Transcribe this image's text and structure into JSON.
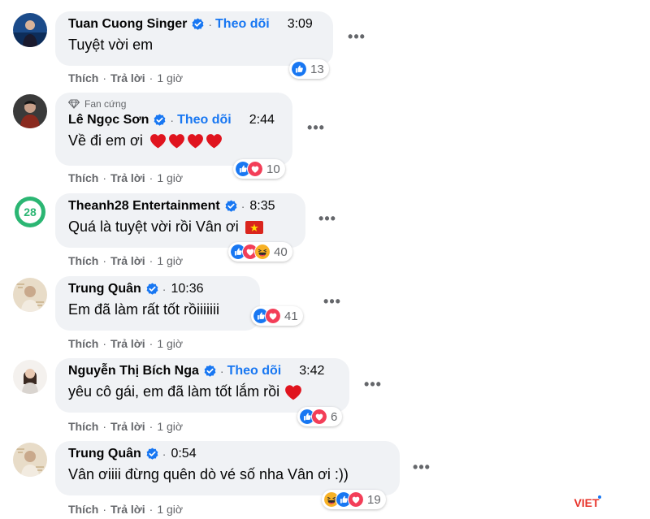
{
  "comments": [
    {
      "author": "Tuan Cuong Singer",
      "follow": "Theo dõi",
      "time": "3:09",
      "text": "Tuyệt vời em",
      "reaction_count": "13",
      "actions": {
        "like": "Thích",
        "reply": "Trả lời",
        "ago": "1 giờ"
      }
    },
    {
      "badge": "Fan cứng",
      "author": "Lê Ngọc Sơn",
      "follow": "Theo dõi",
      "time": "2:44",
      "text": "Về đi em ơi",
      "reaction_count": "10",
      "actions": {
        "like": "Thích",
        "reply": "Trả lời",
        "ago": "1 giờ"
      }
    },
    {
      "author": "Theanh28 Entertainment",
      "time": "8:35",
      "text": "Quá là tuyệt vời rồi Vân ơi",
      "reaction_count": "40",
      "actions": {
        "like": "Thích",
        "reply": "Trả lời",
        "ago": "1 giờ"
      }
    },
    {
      "author": "Trung Quân",
      "time": "10:36",
      "text": "Em đã làm rất tốt rồiiiiiii",
      "reaction_count": "41",
      "actions": {
        "like": "Thích",
        "reply": "Trả lời",
        "ago": "1 giờ"
      }
    },
    {
      "author": "Nguyễn Thị Bích Nga",
      "follow": "Theo dõi",
      "time": "3:42",
      "text": "yêu cô gái, em đã làm tốt lắm rồi",
      "reaction_count": "6",
      "actions": {
        "like": "Thích",
        "reply": "Trả lời",
        "ago": "1 giờ"
      }
    },
    {
      "author": "Trung Quân",
      "time": "0:54",
      "text": "Vân ơiiii đừng quên dò vé số nha Vân ơi :))",
      "reaction_count": "19",
      "actions": {
        "like": "Thích",
        "reply": "Trả lời",
        "ago": "1 giờ"
      }
    }
  ],
  "more_glyph": "•••",
  "separator": "·",
  "colors": {
    "link": "#1877f2",
    "bubble": "#f0f2f5",
    "muted": "#65676b",
    "like": "#1877f2",
    "love": "#f33e58",
    "haha": "#f7b125"
  },
  "icons": {
    "verified": "verified-badge-icon",
    "like": "like-reaction-icon",
    "love": "love-reaction-icon",
    "haha": "haha-reaction-icon",
    "more": "more-options-icon",
    "fan": "diamond-icon"
  }
}
